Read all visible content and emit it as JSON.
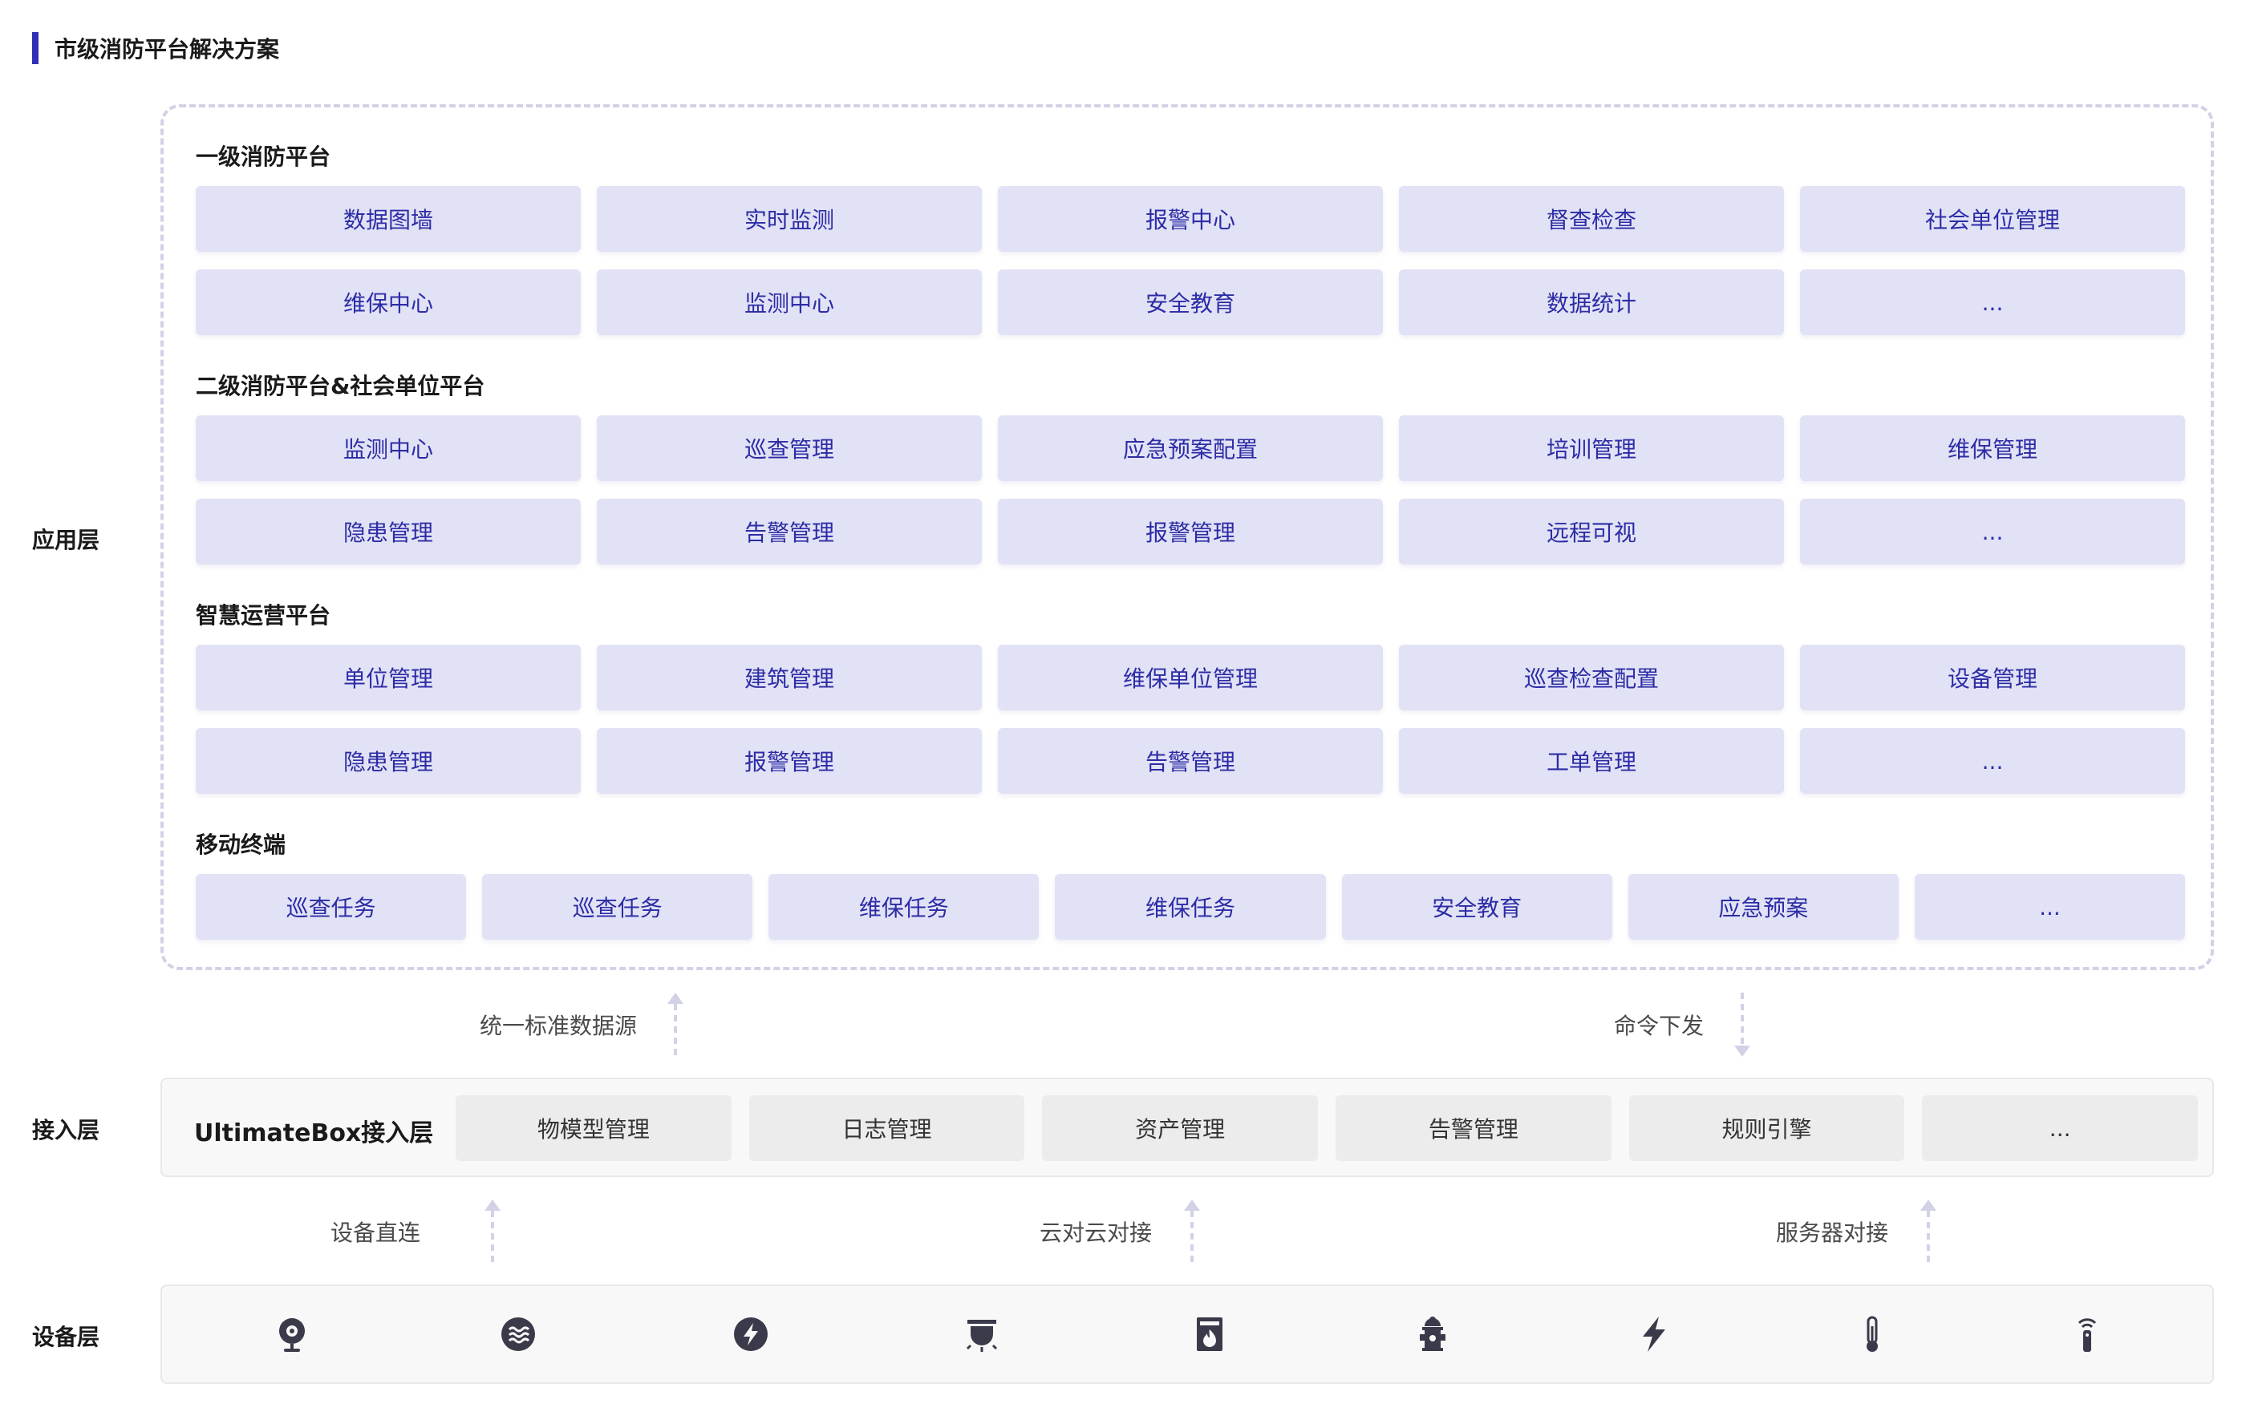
{
  "page_title": "市级消防平台解决方案",
  "layers": {
    "app": "应用层",
    "access": "接入层",
    "device": "设备层"
  },
  "groups": [
    {
      "title": "一级消防平台",
      "items": [
        "数据图墙",
        "实时监测",
        "报警中心",
        "督查检查",
        "社会单位管理",
        "维保中心",
        "监测中心",
        "安全教育",
        "数据统计",
        "..."
      ]
    },
    {
      "title": "二级消防平台&社会单位平台",
      "items": [
        "监测中心",
        "巡查管理",
        "应急预案配置",
        "培训管理",
        "维保管理",
        "隐患管理",
        "告警管理",
        "报警管理",
        "远程可视",
        "..."
      ]
    },
    {
      "title": "智慧运营平台",
      "items": [
        "单位管理",
        "建筑管理",
        "维保单位管理",
        "巡查检查配置",
        "设备管理",
        "隐患管理",
        "报警管理",
        "告警管理",
        "工单管理",
        "..."
      ]
    },
    {
      "title": "移动终端",
      "items": [
        "巡查任务",
        "巡查任务",
        "维保任务",
        "维保任务",
        "安全教育",
        "应急预案",
        "..."
      ]
    }
  ],
  "flows": {
    "up_data": "统一标准数据源",
    "down_cmd": "命令下发",
    "direct": "设备直连",
    "cloud": "云对云对接",
    "server": "服务器对接"
  },
  "access": {
    "name": "UltimateBox接入层",
    "items": [
      "物模型管理",
      "日志管理",
      "资产管理",
      "告警管理",
      "规则引擎",
      "..."
    ]
  },
  "devices": [
    "camera-icon",
    "smoke-detector-icon",
    "electric-detector-icon",
    "alarm-light-icon",
    "fire-cabinet-icon",
    "fire-hydrant-icon",
    "lightning-icon",
    "thermometer-icon",
    "wireless-sensor-icon"
  ],
  "colors": {
    "accent": "#2f2fb8",
    "cell_bg": "#e2e2f6",
    "cell_text": "#2c2ca6",
    "icon": "#3a3a4a"
  }
}
